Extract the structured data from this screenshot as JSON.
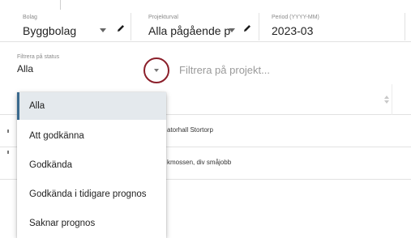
{
  "filters": {
    "bolag": {
      "label": "Bolag",
      "value": "Byggbolag"
    },
    "projekt": {
      "label": "Projekturval",
      "value": "Alla pågående p"
    },
    "period": {
      "label": "Period (YYYY-MM)",
      "value": "2023-03"
    }
  },
  "status": {
    "label": "Filtrera på status",
    "value": "Alla"
  },
  "search": {
    "placeholder": "Filtrera på projekt..."
  },
  "table": {
    "rows": [
      {
        "text": "atorhall Stortorp"
      },
      {
        "text": "kmossen, div småjobb"
      }
    ]
  },
  "dropdown": {
    "options": [
      {
        "label": "Alla",
        "selected": true
      },
      {
        "label": "Att godkänna",
        "selected": false
      },
      {
        "label": "Godkända",
        "selected": false
      },
      {
        "label": "Godkända i tidigare prognos",
        "selected": false
      },
      {
        "label": "Saknar prognos",
        "selected": false
      }
    ]
  },
  "colors": {
    "accent_ring": "#8b1f2a",
    "selected_bg": "#e4e9ed",
    "selected_border": "#3b6a8e"
  }
}
